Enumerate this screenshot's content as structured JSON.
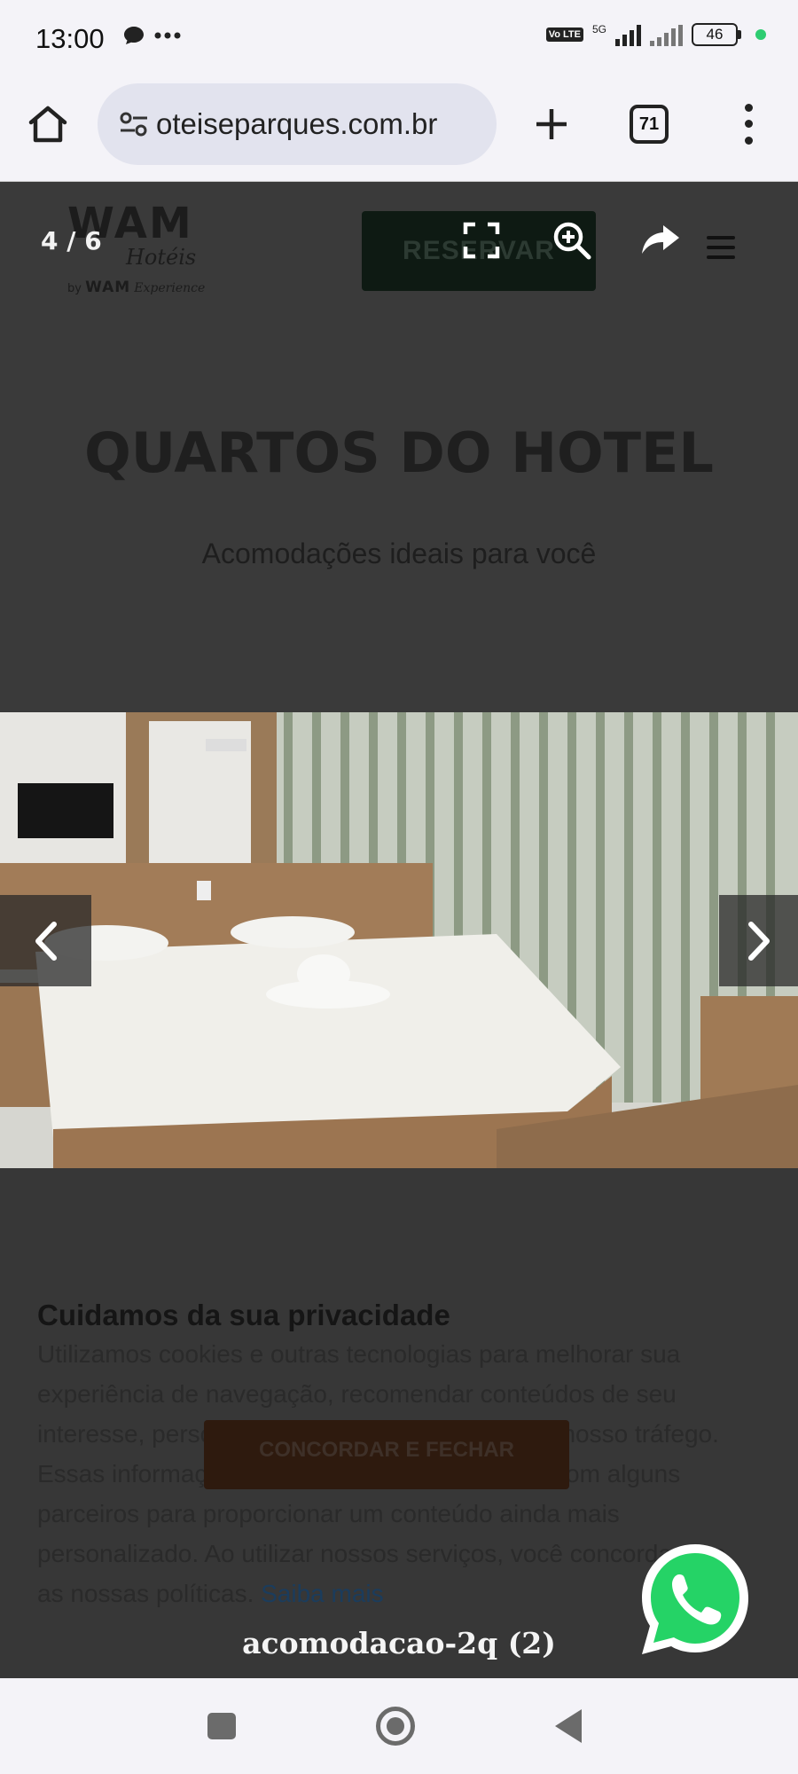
{
  "status_bar": {
    "time": "13:00",
    "network": "5G",
    "volte": "Vo LTE",
    "battery": "46"
  },
  "browser": {
    "url": "oteiseparques.com.br",
    "tab_count": "71"
  },
  "site": {
    "logo_main": "WAM",
    "logo_sub": "Hotéis",
    "logo_by_prefix": "by",
    "logo_by_brand": "WAM",
    "logo_by_suffix": "Experience",
    "reserve_button": "RESERVAR",
    "section_title": "QUARTOS DO HOTEL",
    "section_subtitle": "Acomodações ideais para você"
  },
  "cookie_banner": {
    "title": "Cuidamos da sua privacidade",
    "text": "Utilizamos cookies e outras tecnologias para melhorar sua experiência de navegação, recomendar conteúdos de seu interesse, personalizar publicidade e analisar o nosso tráfego. Essas informações podem ser compartilhadas com alguns parceiros para proporcionar um conteúdo ainda mais personalizado. Ao utilizar nossos serviços, você concorda com as nossas políticas.",
    "link": "Saiba mais",
    "accept_button": "CONCORDAR E FECHAR"
  },
  "lightbox": {
    "counter": "4 / 6",
    "caption": "acomodacao-2q (2)"
  }
}
